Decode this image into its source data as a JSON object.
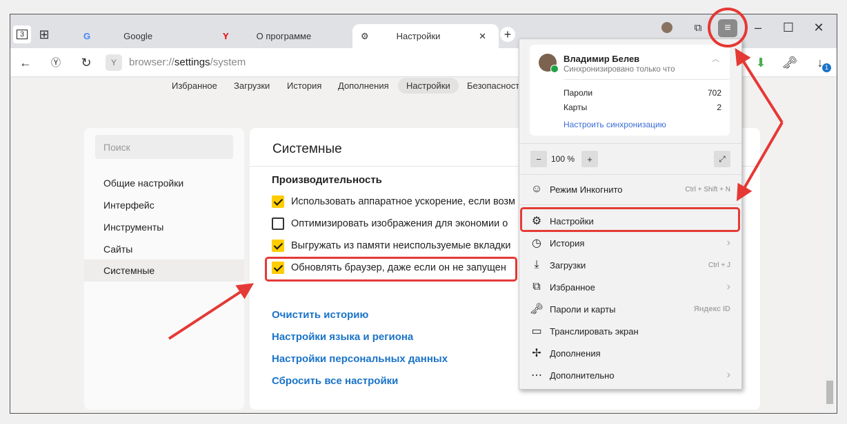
{
  "tabs": [
    {
      "label": "Google",
      "icon": "google-icon"
    },
    {
      "label": "О программе",
      "icon": "yandex-icon"
    },
    {
      "label": "Настройки",
      "icon": "gear-icon"
    }
  ],
  "tab_counter": "3",
  "address": {
    "prefix": "browser://",
    "host": "settings",
    "path": "/system"
  },
  "nav": [
    "Избранное",
    "Загрузки",
    "История",
    "Дополнения",
    "Настройки",
    "Безопасност"
  ],
  "nav_active": 4,
  "sidebar": {
    "search_placeholder": "Поиск",
    "items": [
      "Общие настройки",
      "Интерфейс",
      "Инструменты",
      "Сайты",
      "Системные"
    ],
    "active": 4
  },
  "main": {
    "title": "Системные",
    "section": "Производительность",
    "options": [
      {
        "label": "Использовать аппаратное ускорение, если возм",
        "checked": true
      },
      {
        "label": "Оптимизировать изображения для экономии о",
        "checked": false
      },
      {
        "label": "Выгружать из памяти неиспользуемые вкладки",
        "checked": true
      },
      {
        "label": "Обновлять браузер, даже если он не запущен",
        "checked": true
      }
    ],
    "links": [
      "Очистить историю",
      "Настройки языка и региона",
      "Настройки персональных данных",
      "Сбросить все настройки"
    ]
  },
  "menu": {
    "user_name": "Владимир Белев",
    "sync_status": "Синхронизировано только что",
    "stats": [
      {
        "label": "Пароли",
        "value": "702"
      },
      {
        "label": "Карты",
        "value": "2"
      }
    ],
    "sync_link": "Настроить синхронизацию",
    "zoom": "100 %",
    "items": [
      {
        "label": "Режим Инкогнито",
        "shortcut": "Ctrl + Shift + N",
        "icon": "incognito-mask-icon"
      },
      {
        "label": "Настройки",
        "icon": "gear-icon"
      },
      {
        "label": "История",
        "icon": "clock-icon",
        "submenu": true
      },
      {
        "label": "Загрузки",
        "shortcut": "Ctrl + J",
        "icon": "download-icon"
      },
      {
        "label": "Избранное",
        "icon": "bookmarks-icon",
        "submenu": true
      },
      {
        "label": "Пароли и карты",
        "shortcut": "Яндекс ID",
        "icon": "key-card-icon"
      },
      {
        "label": "Транслировать экран",
        "icon": "cast-icon"
      },
      {
        "label": "Дополнения",
        "icon": "puzzle-icon"
      },
      {
        "label": "Дополнительно",
        "icon": "more-icon",
        "submenu": true
      }
    ]
  },
  "download_badge": "1",
  "colors": {
    "accent": "#fc0",
    "link": "#1a73c8",
    "annotation": "#e53935"
  }
}
